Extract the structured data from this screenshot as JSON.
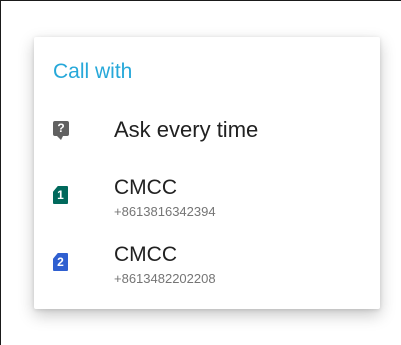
{
  "dialog": {
    "title": "Call with",
    "accent_color": "#26a8d9",
    "options": [
      {
        "icon": "ask-icon",
        "icon_glyph": "?",
        "label": "Ask every time"
      },
      {
        "icon": "sim-card-1-icon",
        "icon_glyph": "1",
        "icon_color": "#00695c",
        "name": "CMCC",
        "number": "+8613816342394"
      },
      {
        "icon": "sim-card-2-icon",
        "icon_glyph": "2",
        "icon_color": "#2f5fd0",
        "name": "CMCC",
        "number": "+8613482202208"
      }
    ]
  }
}
